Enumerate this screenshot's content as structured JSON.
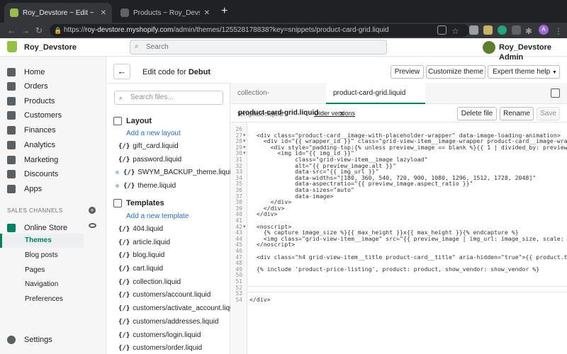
{
  "browser": {
    "tabs": [
      {
        "title": "Roy_Devstore ~ Edit ~ Debut",
        "active": true
      },
      {
        "title": "Products ~ Roy_Devstore",
        "active": false
      }
    ],
    "url_prefix": "https://",
    "url_domain": "roy-devstore.myshopify.com",
    "url_path": "/admin/themes/125528178838?key=snippets/product-card-grid.liquid",
    "profile_initial": "A"
  },
  "topbar": {
    "store_name": "Roy_Devstore",
    "search_placeholder": "Search",
    "admin_name": "Roy_Devstore Admin"
  },
  "sidebar": {
    "items": [
      {
        "label": "Home",
        "icon": "home-icon"
      },
      {
        "label": "Orders",
        "icon": "orders-icon"
      },
      {
        "label": "Products",
        "icon": "products-icon"
      },
      {
        "label": "Customers",
        "icon": "customers-icon"
      },
      {
        "label": "Finances",
        "icon": "finances-icon"
      },
      {
        "label": "Analytics",
        "icon": "analytics-icon"
      },
      {
        "label": "Marketing",
        "icon": "marketing-icon"
      },
      {
        "label": "Discounts",
        "icon": "discounts-icon"
      },
      {
        "label": "Apps",
        "icon": "apps-icon"
      }
    ],
    "channels_header": "SALES CHANNELS",
    "online_store": "Online Store",
    "sub_items": [
      "Themes",
      "Blog posts",
      "Pages",
      "Navigation",
      "Preferences"
    ],
    "active_sub": "Themes",
    "settings": "Settings"
  },
  "editor": {
    "back_label": "←",
    "title_prefix": "Edit code for",
    "theme": "Debut",
    "buttons": {
      "preview": "Preview",
      "customize": "Customize theme",
      "help": "Expert theme help"
    },
    "file_search_placeholder": "Search files...",
    "layout_group": "Layout",
    "add_layout": "Add a new layout",
    "layout_files": [
      {
        "prefix": "{/}",
        "name": "gift_card.liquid"
      },
      {
        "prefix": "{/}",
        "name": "password.liquid"
      },
      {
        "prefix": "{/}",
        "name": "SWYM_BACKUP_theme.liquid"
      },
      {
        "prefix": "{/}",
        "name": "theme.liquid"
      }
    ],
    "templates_group": "Templates",
    "add_template": "Add a new template",
    "template_files": [
      {
        "prefix": "{/}",
        "name": "404.liquid"
      },
      {
        "prefix": "{/}",
        "name": "article.liquid"
      },
      {
        "prefix": "{/}",
        "name": "blog.liquid"
      },
      {
        "prefix": "{/}",
        "name": "cart.liquid"
      },
      {
        "prefix": "{/}",
        "name": "collection.liquid"
      },
      {
        "prefix": "{/}",
        "name": "customers/account.liquid"
      },
      {
        "prefix": "{/}",
        "name": "customers/activate_account.liquid"
      },
      {
        "prefix": "{/}",
        "name": "customers/addresses.liquid"
      },
      {
        "prefix": "{/}",
        "name": "customers/login.liquid"
      },
      {
        "prefix": "{/}",
        "name": "customers/order.liquid"
      }
    ],
    "open_tabs": [
      "collection-template.liquid",
      "product-card-grid.liquid"
    ],
    "current_file": "product-card-grid.liquid",
    "older_versions": "Older versions",
    "file_buttons": {
      "delete": "Delete file",
      "rename": "Rename",
      "save": "Save"
    },
    "line_numbers": [
      "26",
      "27",
      "28",
      "29",
      "30",
      "31",
      "32",
      "33",
      "34",
      "35",
      "36",
      "37",
      "38",
      "39",
      "40",
      "41",
      "42",
      "43",
      "44",
      "45",
      "46",
      "47",
      "48",
      "49",
      "50",
      "51",
      "52",
      "53",
      "54"
    ],
    "fold_lines": [
      "27",
      "28",
      "29",
      "30",
      "42"
    ],
    "code_lines": [
      "",
      "  <div class=\"product-card__image-with-placeholder-wrapper\" data-image-loading-animation>",
      "    <div id=\"{{ wrapper_id }}\" class=\"grid-view-item__image-wrapper product-card__image-wrapper js\">",
      "      <div style=\"padding-top:{% unless preview_image == blank %}{{ 1 | divided_by: preview_image.aspect_ratio",
      "        <img id=\"{{ img_id }}\"",
      "             class=\"grid-view-item__image lazyload\"",
      "             alt=\"{{ preview_image.alt }}\"",
      "             data-src=\"{{ img_url }}\"",
      "             data-widths=\"[180, 360, 540, 720, 900, 1080, 1296, 1512, 1728, 2048]\"",
      "             data-aspectratio=\"{{ preview_image.aspect_ratio }}\"",
      "             data-sizes=\"auto\"",
      "             data-image>",
      "      </div>",
      "    </div>",
      "  </div>",
      "",
      "  <noscript>",
      "    {% capture image_size %}{{ max_height }}x{{ max_height }}{% endcapture %}",
      "    <img class=\"grid-view-item__image\" src=\"{{ preview_image | img_url: image_size, scale: 2 }}\"",
      "  </noscript>",
      "",
      "  <div class=\"h4 grid-view-item__title product-card__title\" aria-hidden=\"true\">{{ product.title }}</div>",
      "",
      "  {% include 'product-price-listing', product: product, show_vendor: show_vendor %}",
      "",
      "",
      "",
      "",
      "</div>"
    ]
  }
}
